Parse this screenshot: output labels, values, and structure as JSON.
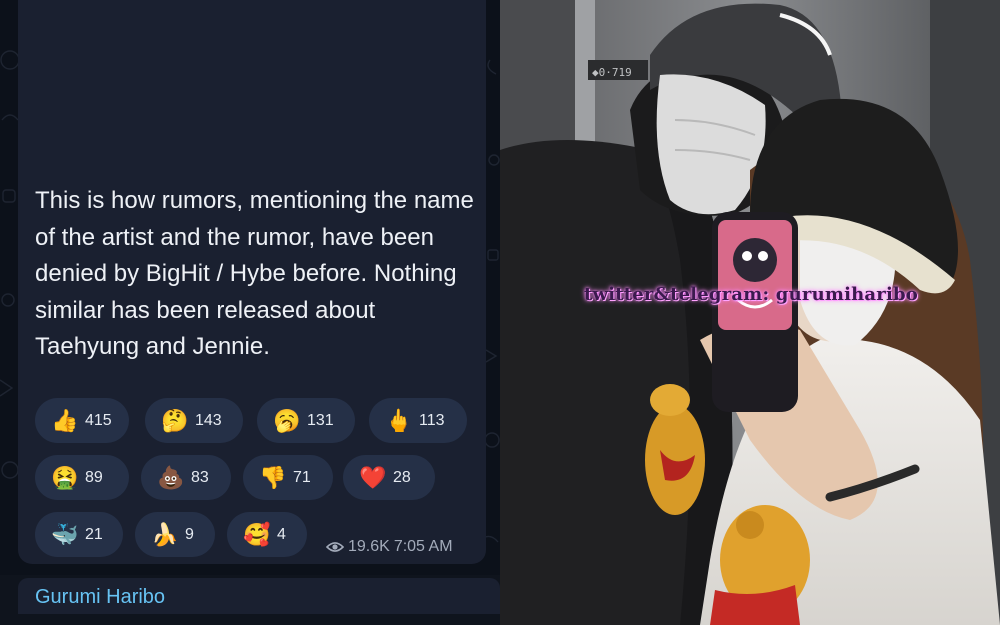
{
  "message": {
    "text": "This is how rumors, mentioning the name of the artist and the rumor, have been denied by BigHit / Hybe before. Nothing similar has been released about Taehyung and Jennie.",
    "sender": "Gurumi Haribo",
    "views": "19.6K",
    "time": "7:05 AM"
  },
  "reactions": [
    {
      "emoji": "👍",
      "count": "415"
    },
    {
      "emoji": "🤔",
      "count": "143"
    },
    {
      "emoji": "🥱",
      "count": "131"
    },
    {
      "emoji": "🖕",
      "count": "113"
    },
    {
      "emoji": "🤮",
      "count": "89"
    },
    {
      "emoji": "💩",
      "count": "83"
    },
    {
      "emoji": "👎",
      "count": "71"
    },
    {
      "emoji": "❤️",
      "count": "28"
    },
    {
      "emoji": "🐳",
      "count": "21"
    },
    {
      "emoji": "🍌",
      "count": "9"
    },
    {
      "emoji": "🥰",
      "count": "4"
    }
  ],
  "photo": {
    "watermark": "twitter&telegram: gurumiharibo"
  },
  "colors": {
    "bubble": "#1a2030",
    "chip": "#253047",
    "sender_name": "#67c3f3"
  }
}
